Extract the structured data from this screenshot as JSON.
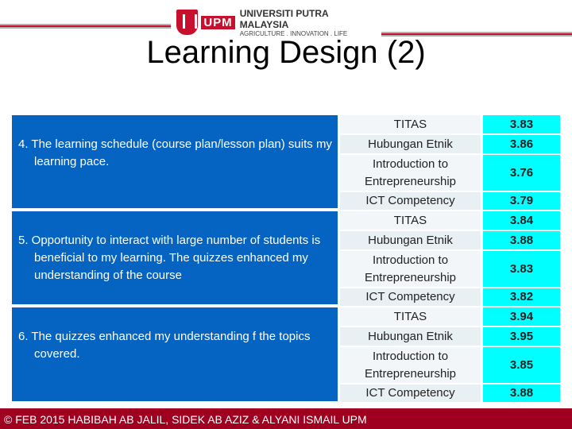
{
  "header": {
    "logo_abbrev": "UPM",
    "university": "UNIVERSITI PUTRA MALAYSIA",
    "tagline": "AGRICULTURE . INNOVATION . LIFE"
  },
  "title": "Learning Design (2)",
  "groups": [
    {
      "question": "4.  The learning  schedule (course plan/lesson plan) suits my learning pace.",
      "rows": [
        {
          "course": "TITAS",
          "score": "3.83"
        },
        {
          "course": "Hubungan Etnik",
          "score": "3.86"
        },
        {
          "course": "Introduction to Entrepreneurship",
          "score": "3.76"
        },
        {
          "course": "ICT Competency",
          "score": "3.79"
        }
      ]
    },
    {
      "question": "5.  Opportunity to interact with large number of students  is beneficial to my learning. The quizzes enhanced my understanding  of the course",
      "rows": [
        {
          "course": "TITAS",
          "score": "3.84"
        },
        {
          "course": "Hubungan Etnik",
          "score": "3.88"
        },
        {
          "course": "Introduction to Entrepreneurship",
          "score": "3.83"
        },
        {
          "course": "ICT Competency",
          "score": "3.82"
        }
      ]
    },
    {
      "question": "6.   The quizzes  enhanced my understanding f the topics  covered.",
      "rows": [
        {
          "course": "TITAS",
          "score": "3.94"
        },
        {
          "course": "Hubungan Etnik",
          "score": "3.95"
        },
        {
          "course": "Introduction to Entrepreneurship",
          "score": "3.85"
        },
        {
          "course": "ICT Competency",
          "score": "3.88"
        }
      ]
    }
  ],
  "footer": "© FEB 2015 HABIBAH AB JALIL, SIDEK AB AZIZ & ALYANI ISMAIL UPM",
  "colors": {
    "question_bg": "#0563c1",
    "score_bg": "#00ffff",
    "footer_bg": "#a00020"
  }
}
